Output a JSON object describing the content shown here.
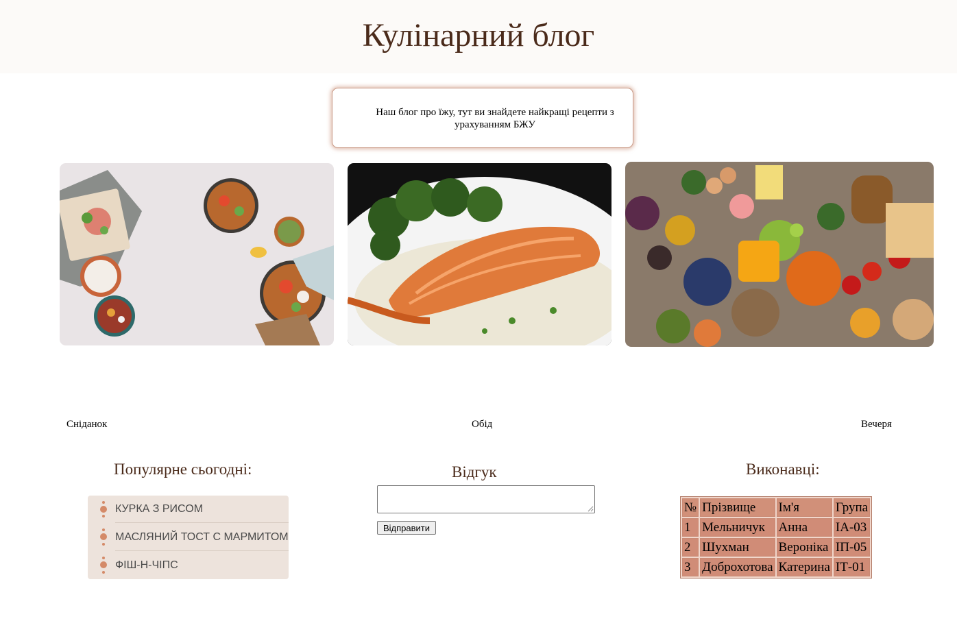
{
  "header": {
    "title": "Кулінарний блог"
  },
  "intro": {
    "text": "Наш блог про їжу, тут ви знайдете найкращі рецепти з урахуванням БЖУ"
  },
  "meals": [
    {
      "caption": "Сніданок",
      "image": "breakfast-photo"
    },
    {
      "caption": "Обід",
      "image": "salmon-photo"
    },
    {
      "caption": "Вечеря",
      "image": "groceries-photo"
    }
  ],
  "popular": {
    "title": "Популярне сьогодні:",
    "items": [
      "КУРКА З РИСОМ",
      "МАСЛЯНИЙ ТОСТ С МАРМИТОМ",
      "ФІШ-Н-ЧІПС"
    ]
  },
  "feedback": {
    "title": "Відгук",
    "value": "",
    "button_label": "Відправити"
  },
  "authors": {
    "title": "Виконавці:",
    "columns": [
      "№",
      "Прізвище",
      "Ім'я",
      "Група"
    ],
    "rows": [
      [
        "1",
        "Мельничук",
        "Анна",
        "ІА-03"
      ],
      [
        "2",
        "Шухман",
        "Вероніка",
        "ІП-05"
      ],
      [
        "3",
        "Доброхотова",
        "Катерина",
        "ІТ-01"
      ]
    ]
  },
  "colors": {
    "title": "#4a2a1a",
    "accent": "#d48a68",
    "list_bg": "#ede3dc",
    "table_cell": "#d08c77",
    "header_bg": "#fcfaf8"
  }
}
